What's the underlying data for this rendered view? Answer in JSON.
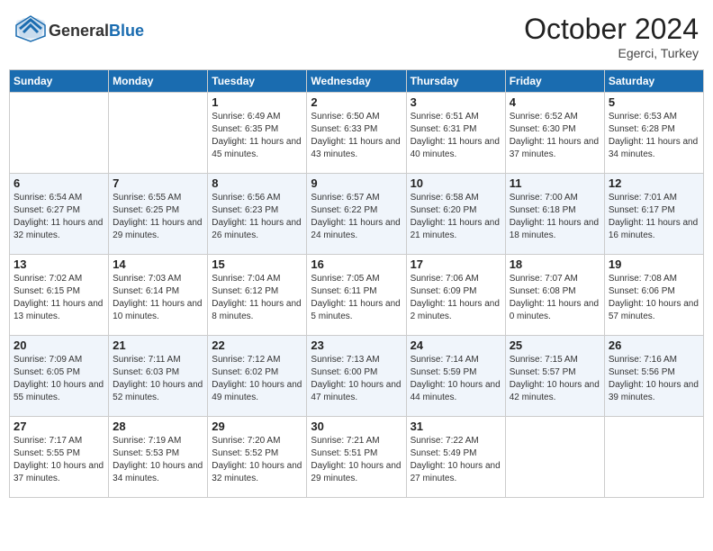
{
  "header": {
    "logo_general": "General",
    "logo_blue": "Blue",
    "month": "October 2024",
    "location": "Egerci, Turkey"
  },
  "days_of_week": [
    "Sunday",
    "Monday",
    "Tuesday",
    "Wednesday",
    "Thursday",
    "Friday",
    "Saturday"
  ],
  "weeks": [
    [
      {
        "num": "",
        "info": ""
      },
      {
        "num": "",
        "info": ""
      },
      {
        "num": "1",
        "info": "Sunrise: 6:49 AM\nSunset: 6:35 PM\nDaylight: 11 hours and 45 minutes."
      },
      {
        "num": "2",
        "info": "Sunrise: 6:50 AM\nSunset: 6:33 PM\nDaylight: 11 hours and 43 minutes."
      },
      {
        "num": "3",
        "info": "Sunrise: 6:51 AM\nSunset: 6:31 PM\nDaylight: 11 hours and 40 minutes."
      },
      {
        "num": "4",
        "info": "Sunrise: 6:52 AM\nSunset: 6:30 PM\nDaylight: 11 hours and 37 minutes."
      },
      {
        "num": "5",
        "info": "Sunrise: 6:53 AM\nSunset: 6:28 PM\nDaylight: 11 hours and 34 minutes."
      }
    ],
    [
      {
        "num": "6",
        "info": "Sunrise: 6:54 AM\nSunset: 6:27 PM\nDaylight: 11 hours and 32 minutes."
      },
      {
        "num": "7",
        "info": "Sunrise: 6:55 AM\nSunset: 6:25 PM\nDaylight: 11 hours and 29 minutes."
      },
      {
        "num": "8",
        "info": "Sunrise: 6:56 AM\nSunset: 6:23 PM\nDaylight: 11 hours and 26 minutes."
      },
      {
        "num": "9",
        "info": "Sunrise: 6:57 AM\nSunset: 6:22 PM\nDaylight: 11 hours and 24 minutes."
      },
      {
        "num": "10",
        "info": "Sunrise: 6:58 AM\nSunset: 6:20 PM\nDaylight: 11 hours and 21 minutes."
      },
      {
        "num": "11",
        "info": "Sunrise: 7:00 AM\nSunset: 6:18 PM\nDaylight: 11 hours and 18 minutes."
      },
      {
        "num": "12",
        "info": "Sunrise: 7:01 AM\nSunset: 6:17 PM\nDaylight: 11 hours and 16 minutes."
      }
    ],
    [
      {
        "num": "13",
        "info": "Sunrise: 7:02 AM\nSunset: 6:15 PM\nDaylight: 11 hours and 13 minutes."
      },
      {
        "num": "14",
        "info": "Sunrise: 7:03 AM\nSunset: 6:14 PM\nDaylight: 11 hours and 10 minutes."
      },
      {
        "num": "15",
        "info": "Sunrise: 7:04 AM\nSunset: 6:12 PM\nDaylight: 11 hours and 8 minutes."
      },
      {
        "num": "16",
        "info": "Sunrise: 7:05 AM\nSunset: 6:11 PM\nDaylight: 11 hours and 5 minutes."
      },
      {
        "num": "17",
        "info": "Sunrise: 7:06 AM\nSunset: 6:09 PM\nDaylight: 11 hours and 2 minutes."
      },
      {
        "num": "18",
        "info": "Sunrise: 7:07 AM\nSunset: 6:08 PM\nDaylight: 11 hours and 0 minutes."
      },
      {
        "num": "19",
        "info": "Sunrise: 7:08 AM\nSunset: 6:06 PM\nDaylight: 10 hours and 57 minutes."
      }
    ],
    [
      {
        "num": "20",
        "info": "Sunrise: 7:09 AM\nSunset: 6:05 PM\nDaylight: 10 hours and 55 minutes."
      },
      {
        "num": "21",
        "info": "Sunrise: 7:11 AM\nSunset: 6:03 PM\nDaylight: 10 hours and 52 minutes."
      },
      {
        "num": "22",
        "info": "Sunrise: 7:12 AM\nSunset: 6:02 PM\nDaylight: 10 hours and 49 minutes."
      },
      {
        "num": "23",
        "info": "Sunrise: 7:13 AM\nSunset: 6:00 PM\nDaylight: 10 hours and 47 minutes."
      },
      {
        "num": "24",
        "info": "Sunrise: 7:14 AM\nSunset: 5:59 PM\nDaylight: 10 hours and 44 minutes."
      },
      {
        "num": "25",
        "info": "Sunrise: 7:15 AM\nSunset: 5:57 PM\nDaylight: 10 hours and 42 minutes."
      },
      {
        "num": "26",
        "info": "Sunrise: 7:16 AM\nSunset: 5:56 PM\nDaylight: 10 hours and 39 minutes."
      }
    ],
    [
      {
        "num": "27",
        "info": "Sunrise: 7:17 AM\nSunset: 5:55 PM\nDaylight: 10 hours and 37 minutes."
      },
      {
        "num": "28",
        "info": "Sunrise: 7:19 AM\nSunset: 5:53 PM\nDaylight: 10 hours and 34 minutes."
      },
      {
        "num": "29",
        "info": "Sunrise: 7:20 AM\nSunset: 5:52 PM\nDaylight: 10 hours and 32 minutes."
      },
      {
        "num": "30",
        "info": "Sunrise: 7:21 AM\nSunset: 5:51 PM\nDaylight: 10 hours and 29 minutes."
      },
      {
        "num": "31",
        "info": "Sunrise: 7:22 AM\nSunset: 5:49 PM\nDaylight: 10 hours and 27 minutes."
      },
      {
        "num": "",
        "info": ""
      },
      {
        "num": "",
        "info": ""
      }
    ]
  ]
}
